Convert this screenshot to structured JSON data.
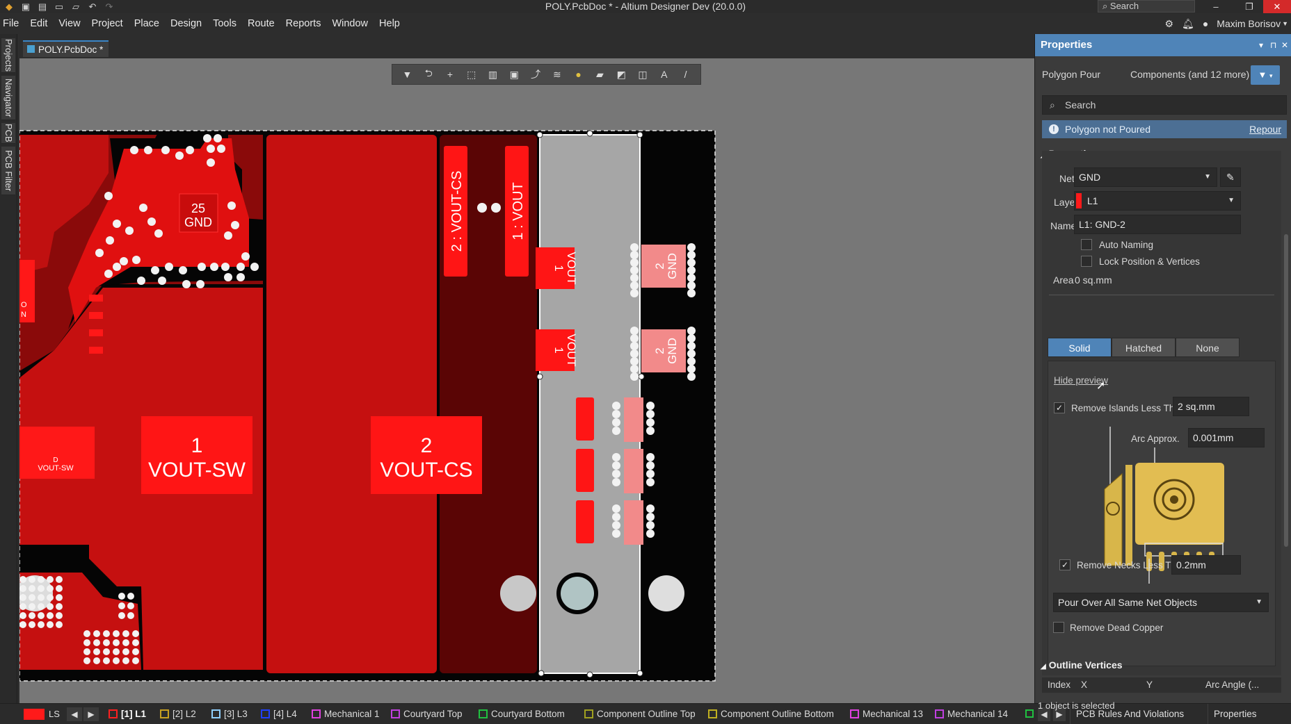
{
  "window": {
    "title": "POLY.PcbDoc * - Altium Designer Dev (20.0.0)",
    "search_placeholder": "Search",
    "minimize": "–",
    "restore": "❐",
    "close": "✕"
  },
  "menu": [
    "File",
    "Edit",
    "View",
    "Project",
    "Place",
    "Design",
    "Tools",
    "Route",
    "Reports",
    "Window",
    "Help"
  ],
  "user": {
    "name": "Maxim Borisov"
  },
  "left_tabs": [
    "Projects",
    "Navigator",
    "PCB",
    "PCB Filter"
  ],
  "document_tab": {
    "label": "POLY.PcbDoc *"
  },
  "pcb_labels": {
    "u1_pin": "25",
    "u1_net": "GND",
    "pad1_num": "1",
    "pad1_net": "VOUT-SW",
    "pad2_num": "2",
    "pad2_net": "VOUT-CS",
    "pad_vcs_vertical": "2 : VOUT-CS",
    "pad_vout_vertical": "1 : VOUT",
    "small_vout_num": "1",
    "small_vout_net": "VOUT",
    "gnd_num": "2",
    "gnd_net": "GND",
    "left_small": "VOUT-SW",
    "left_small_d": "D",
    "left_edge_a": "O",
    "left_edge_b": "N"
  },
  "properties": {
    "header": "Properties",
    "object_type": "Polygon Pour",
    "filter_scope": "Components (and 12 more)",
    "search_placeholder": "Search",
    "warning": "Polygon not Poured",
    "repour": "Repour",
    "section": "Properties",
    "net_label": "Net",
    "net_value": "GND",
    "layer_label": "Layer",
    "layer_value": "L1",
    "layer_color": "#ff1a1a",
    "name_label": "Name",
    "name_value": "L1: GND-2",
    "auto_naming": "Auto Naming",
    "lock_position": "Lock Position & Vertices",
    "area_label": "Area",
    "area_value": "0 sq.mm",
    "fill_modes": [
      "Solid",
      "Hatched",
      "None"
    ],
    "active_fill": "Solid",
    "hide_preview": "Hide preview",
    "remove_islands": "Remove Islands Less Than",
    "remove_islands_checked": true,
    "islands_value": "2 sq.mm",
    "arc_approx_label": "Arc Approx.",
    "arc_approx_value": "0.001mm",
    "remove_necks": "Remove Necks Less Than",
    "remove_necks_checked": true,
    "necks_value": "0.2mm",
    "pour_over": "Pour Over All Same Net Objects",
    "remove_dead_copper": "Remove Dead Copper",
    "outline_section": "Outline Vertices",
    "table_columns": [
      "Index",
      "X",
      "Y",
      "Arc Angle (..."
    ]
  },
  "status": {
    "current_layer_box": "LS",
    "selection": "1 object is selected",
    "layers": [
      {
        "label": "[1] L1",
        "color": "#ff2020",
        "current": true
      },
      {
        "label": "[2] L2",
        "color": "#c8a020"
      },
      {
        "label": "[3] L3",
        "color": "#8fd0ff"
      },
      {
        "label": "[4] L4",
        "color": "#2040ff"
      },
      {
        "label": "Mechanical 1",
        "color": "#e040e0"
      },
      {
        "label": "Courtyard Top",
        "color": "#c040e0"
      },
      {
        "label": "Courtyard Bottom",
        "color": "#20c040"
      },
      {
        "label": "Component Outline Top",
        "color": "#a0a020"
      },
      {
        "label": "Component Outline Bottom",
        "color": "#c0b020"
      },
      {
        "label": "Mechanical 13",
        "color": "#e040e0"
      },
      {
        "label": "Mechanical 14",
        "color": "#c040e0"
      }
    ],
    "panel_tabs": [
      "PCB Rules And Violations",
      "Properties"
    ]
  }
}
